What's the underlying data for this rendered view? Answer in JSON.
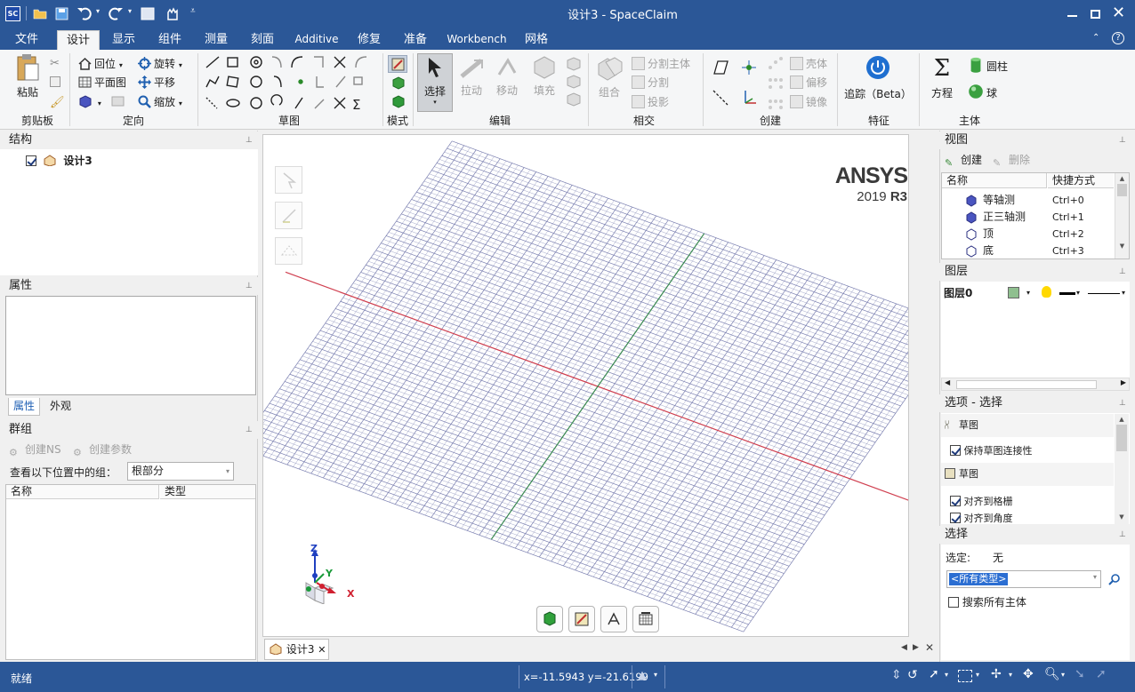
{
  "title": "设计3 - SpaceClaim",
  "app_badge": "SC",
  "ribbon_tabs": [
    {
      "label": "文件",
      "active": false
    },
    {
      "label": "设计",
      "active": true
    },
    {
      "label": "显示",
      "active": false
    },
    {
      "label": "组件",
      "active": false
    },
    {
      "label": "测量",
      "active": false
    },
    {
      "label": "刻面",
      "active": false
    },
    {
      "label": "Additive",
      "active": false
    },
    {
      "label": "修复",
      "active": false
    },
    {
      "label": "准备",
      "active": false
    },
    {
      "label": "Workbench",
      "active": false
    },
    {
      "label": "网格",
      "active": false
    }
  ],
  "ribbon": {
    "clipboard": {
      "paste": "粘贴",
      "label": "剪贴板"
    },
    "orient": {
      "home": "回位",
      "plan": "平面图",
      "spin": "旋转",
      "pan": "平移",
      "zoom": "缩放",
      "label": "定向"
    },
    "sketch": {
      "label": "草图"
    },
    "mode": {
      "label": "模式"
    },
    "edit": {
      "select": "选择",
      "pull": "拉动",
      "move": "移动",
      "fill": "填充",
      "label": "编辑"
    },
    "intersect": {
      "combine": "组合",
      "split_body": "分割主体",
      "split": "分割",
      "project": "投影",
      "label": "相交"
    },
    "create": {
      "shell": "壳体",
      "offset": "偏移",
      "mirror": "镜像",
      "label": "创建"
    },
    "feature": {
      "track": "追踪（Beta）",
      "label": "特征"
    },
    "body": {
      "equation": "方程",
      "cylinder": "圆柱",
      "sphere": "球",
      "label": "主体"
    }
  },
  "structure": {
    "title": "结构",
    "item": "设计3"
  },
  "properties": {
    "title": "属性",
    "tabs": [
      "属性",
      "外观"
    ]
  },
  "groups": {
    "title": "群组",
    "create_ns": "创建NS",
    "create_param": "创建参数",
    "view_label": "查看以下位置中的组：",
    "view_value": "根部分",
    "columns": [
      "名称",
      "类型"
    ]
  },
  "views": {
    "title": "视图",
    "create": "创建",
    "delete": "删除",
    "columns": [
      "名称",
      "快捷方式"
    ],
    "rows": [
      {
        "name": "等轴测",
        "shortcut": "Ctrl+0"
      },
      {
        "name": "正三轴测",
        "shortcut": "Ctrl+1"
      },
      {
        "name": "顶",
        "shortcut": "Ctrl+2"
      },
      {
        "name": "底",
        "shortcut": "Ctrl+3"
      }
    ]
  },
  "layers": {
    "title": "图层",
    "layer": "图层0"
  },
  "options": {
    "title": "选项 - 选择",
    "sketch1": "草图",
    "keep_connectivity": "保持草图连接性",
    "sketch2": "草图",
    "snap_grid": "对齐到格栅",
    "snap_angle": "对齐到角度"
  },
  "selection": {
    "title": "选择",
    "selected_label": "选定:",
    "selected_value": "无",
    "type_value": "<所有类型>",
    "search_all": "搜索所有主体"
  },
  "viewport": {
    "brand": "ANSYS",
    "version": "2019",
    "version_suffix": "R3",
    "axes": {
      "z": "Z",
      "y": "Y",
      "x": "X"
    },
    "doc_tab": "设计3"
  },
  "status": {
    "ready": "就绪",
    "coords": "x=-11.5943  y=-21.6199"
  },
  "colors": {
    "titlebar": "#2b5797",
    "x_axis": "#d04050",
    "y_axis": "#3a8a50",
    "grid": "#7a7fb0"
  }
}
